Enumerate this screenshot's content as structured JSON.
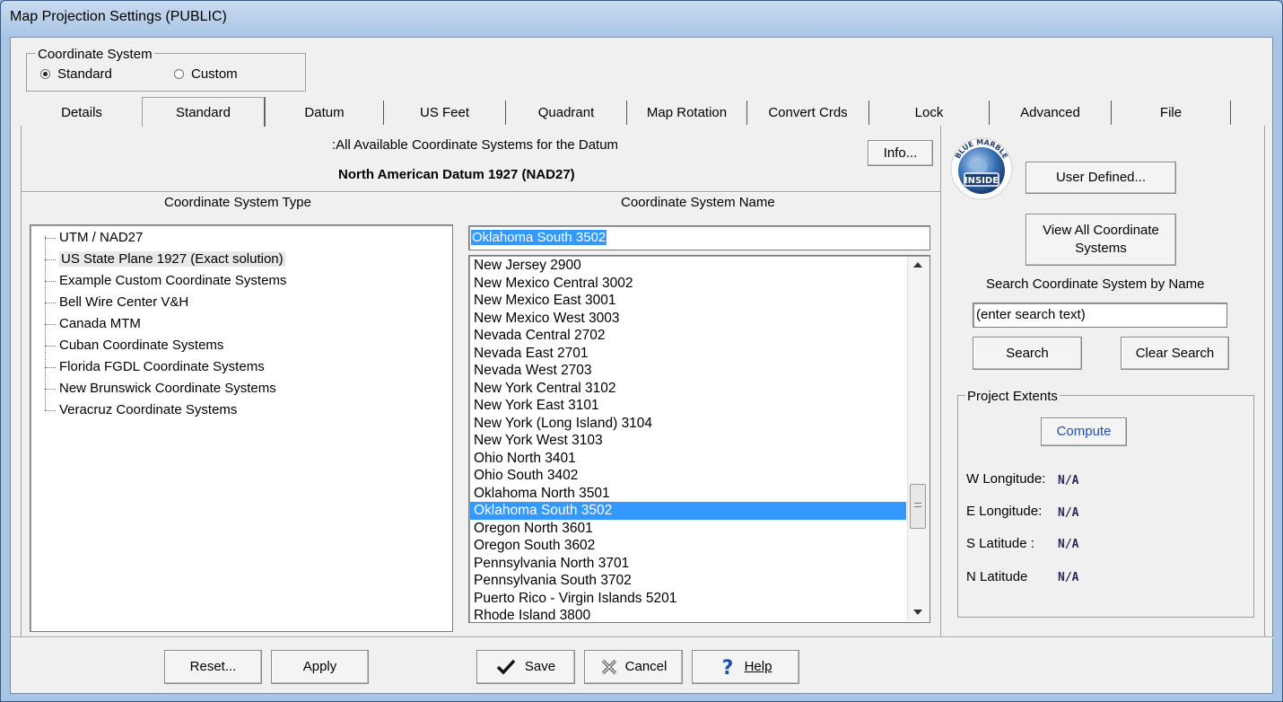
{
  "window": {
    "title": "Map Projection Settings (PUBLIC)"
  },
  "coordinate_system": {
    "group_label": "Coordinate System",
    "options": [
      {
        "label": "Standard",
        "selected": true
      },
      {
        "label": "Custom",
        "selected": false
      }
    ]
  },
  "tabs": [
    {
      "label": "Details",
      "active": false
    },
    {
      "label": "Standard",
      "active": true
    },
    {
      "label": "Datum",
      "active": false
    },
    {
      "label": "US Feet",
      "active": false
    },
    {
      "label": "Quadrant",
      "active": false
    },
    {
      "label": "Map Rotation",
      "active": false
    },
    {
      "label": "Convert Crds",
      "active": false
    },
    {
      "label": "Lock",
      "active": false
    },
    {
      "label": "Advanced",
      "active": false
    },
    {
      "label": "File",
      "active": false
    }
  ],
  "standard": {
    "header_caption": ":All Available Coordinate Systems for the Datum",
    "datum_name": "North American Datum 1927 (NAD27)",
    "info_button": "Info...",
    "type_header": "Coordinate System Type",
    "name_header": "Coordinate System Name",
    "types": [
      "UTM / NAD27",
      "US State Plane 1927 (Exact solution)",
      "Example Custom Coordinate Systems",
      "Bell Wire Center V&H",
      "Canada MTM",
      "Cuban Coordinate Systems",
      "Florida FGDL Coordinate Systems",
      "New Brunswick Coordinate Systems",
      "Veracruz Coordinate Systems"
    ],
    "selected_type": "US State Plane 1927 (Exact solution)",
    "name_field_value": "Oklahoma South 3502",
    "names": [
      "New Jersey 2900",
      "New Mexico Central 3002",
      "New Mexico East 3001",
      "New Mexico West 3003",
      "Nevada Central 2702",
      "Nevada East 2701",
      "Nevada West 2703",
      "New York Central 3102",
      "New York East 3101",
      "New York (Long Island) 3104",
      "New York West 3103",
      "Ohio North 3401",
      "Ohio South 3402",
      "Oklahoma North 3501",
      "Oklahoma South 3502",
      "Oregon North 3601",
      "Oregon South 3602",
      "Pennsylvania North 3701",
      "Pennsylvania South 3702",
      "Puerto Rico - Virgin Islands 5201",
      "Rhode Island 3800"
    ],
    "selected_name": "Oklahoma South 3502"
  },
  "right_panel": {
    "logo_text_top": "BLUE MARBLE",
    "logo_text_inside": "INSIDE",
    "user_defined_button": "User Defined...",
    "view_all_button": "View All Coordinate Systems",
    "search_label": "Search Coordinate System by Name",
    "search_placeholder": "(enter search text)",
    "search_button": "Search",
    "clear_search_button": "Clear Search",
    "extents": {
      "group_label": "Project Extents",
      "compute_button": "Compute",
      "rows": [
        {
          "label": "W Longitude:",
          "value": "N/A"
        },
        {
          "label": "E Longitude:",
          "value": "N/A"
        },
        {
          "label": "S Latitude :",
          "value": "N/A"
        },
        {
          "label": "N Latitude",
          "value": "N/A"
        }
      ]
    }
  },
  "footer": {
    "reset": "Reset...",
    "apply": "Apply",
    "save": "Save",
    "cancel": "Cancel",
    "help": "Help"
  },
  "colors": {
    "selection": "#3399ff",
    "compute_text": "#1f4fbf"
  },
  "icons": {
    "save": "checkmark-icon",
    "cancel": "x-icon",
    "help": "question-mark-icon"
  }
}
